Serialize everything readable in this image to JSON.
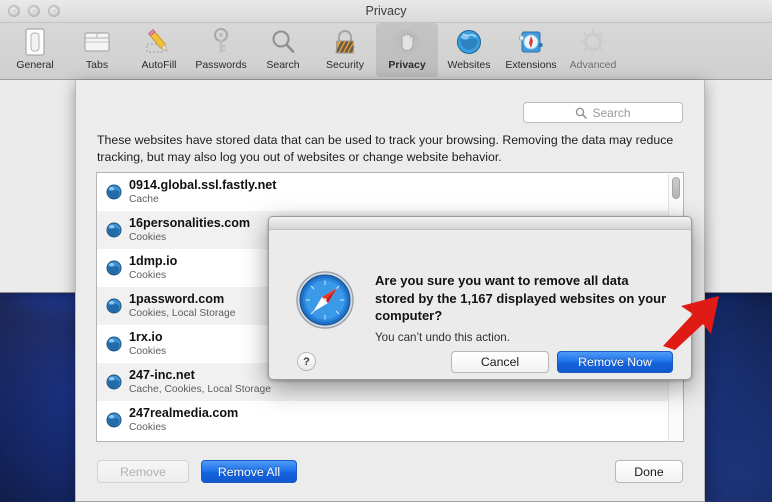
{
  "window": {
    "title": "Privacy",
    "traffic_lights": [
      "close-button",
      "minimize-button",
      "zoom-button"
    ]
  },
  "toolbar": {
    "items": [
      {
        "label": "General",
        "icon": "general-icon",
        "selected": false
      },
      {
        "label": "Tabs",
        "icon": "tabs-icon",
        "selected": false
      },
      {
        "label": "AutoFill",
        "icon": "autofill-icon",
        "selected": false
      },
      {
        "label": "Passwords",
        "icon": "passwords-icon",
        "selected": false
      },
      {
        "label": "Search",
        "icon": "search-icon",
        "selected": false
      },
      {
        "label": "Security",
        "icon": "security-icon",
        "selected": false
      },
      {
        "label": "Privacy",
        "icon": "privacy-icon",
        "selected": true
      },
      {
        "label": "Websites",
        "icon": "websites-icon",
        "selected": false
      },
      {
        "label": "Extensions",
        "icon": "extensions-icon",
        "selected": false
      },
      {
        "label": "Advanced",
        "icon": "advanced-icon",
        "selected": false
      }
    ]
  },
  "pane": {
    "search": {
      "placeholder": "Search",
      "value": "",
      "icon": "magnifier-icon"
    },
    "description": "These websites have stored data that can be used to track your browsing. Removing the data may reduce tracking, but may also log you out of websites or change website behavior.",
    "help_label": "?",
    "buttons": {
      "remove": "Remove",
      "remove_all": "Remove All",
      "done": "Done"
    },
    "websites": [
      {
        "domain": "0914.global.ssl.fastly.net",
        "storage": "Cache"
      },
      {
        "domain": "16personalities.com",
        "storage": "Cookies"
      },
      {
        "domain": "1dmp.io",
        "storage": "Cookies"
      },
      {
        "domain": "1password.com",
        "storage": "Cookies, Local Storage"
      },
      {
        "domain": "1rx.io",
        "storage": "Cookies"
      },
      {
        "domain": "247-inc.net",
        "storage": "Cache, Cookies, Local Storage"
      },
      {
        "domain": "247realmedia.com",
        "storage": "Cookies"
      }
    ]
  },
  "alert": {
    "app_icon": "safari-compass-icon",
    "message": "Are you sure you want to remove all data stored by the 1,167 displayed websites on your computer?",
    "informative": "You can’t undo this action.",
    "help_label": "?",
    "cancel_label": "Cancel",
    "confirm_label": "Remove Now"
  },
  "annotation": {
    "arrow": "red-arrow-pointing-to-remove-now",
    "color": "#e01b16"
  },
  "colors": {
    "accent_blue": "#1f71ea",
    "window_bg": "#ebebeb",
    "pane_bg": "#ececec",
    "row_alt": "#f1f1f1",
    "desktop": "#0a1020"
  }
}
